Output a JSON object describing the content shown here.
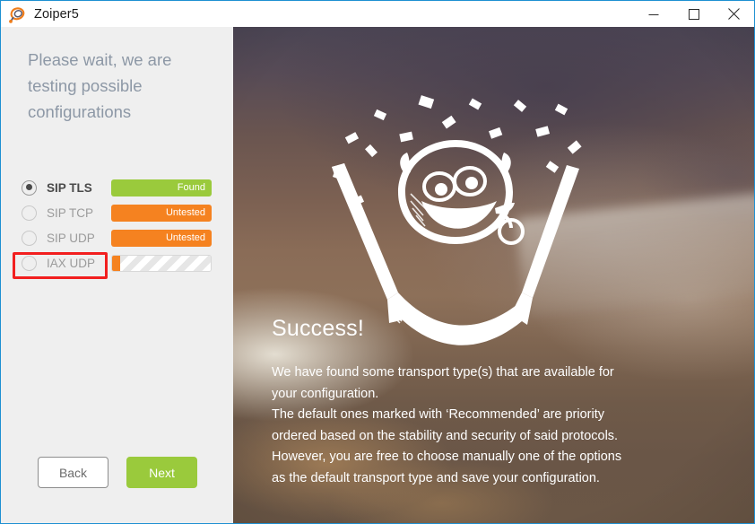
{
  "window": {
    "title": "Zoiper5",
    "icon": "zoiper-headset-icon",
    "controls": {
      "minimize": "minimize-button",
      "maximize": "maximize-button",
      "close": "close-button"
    },
    "border_color": "#1e90d2"
  },
  "left_panel": {
    "heading": "Please wait, we are testing possible configurations",
    "background_color": "#efefef",
    "transports": [
      {
        "label": "SIP TLS",
        "selected": true,
        "status_kind": "badge",
        "status_text": "Found",
        "status_color": "#9aca3c"
      },
      {
        "label": "SIP TCP",
        "selected": false,
        "status_kind": "badge",
        "status_text": "Untested",
        "status_color": "#f58220"
      },
      {
        "label": "SIP UDP",
        "selected": false,
        "status_kind": "badge",
        "status_text": "Untested",
        "status_color": "#f58220",
        "highlighted": true,
        "highlight_color": "#f21f1f"
      },
      {
        "label": "IAX UDP",
        "selected": false,
        "status_kind": "progress",
        "status_text": "",
        "progress_percent": 8,
        "status_color": "#f58220"
      }
    ],
    "buttons": {
      "back": "Back",
      "next": "Next",
      "next_color": "#9aca3c"
    }
  },
  "right_panel": {
    "heading": "Success!",
    "body_lines": [
      "We have found some transport type(s) that are available for",
      "your configuration.",
      "The default ones marked with ‘Recommended’ are priority",
      "ordered based on the stability and security of said protocols.",
      "However, you are free to choose manually one of the options",
      "as the default  transport type and save your configuration."
    ],
    "artwork": "smiley-celebration-illustration"
  }
}
